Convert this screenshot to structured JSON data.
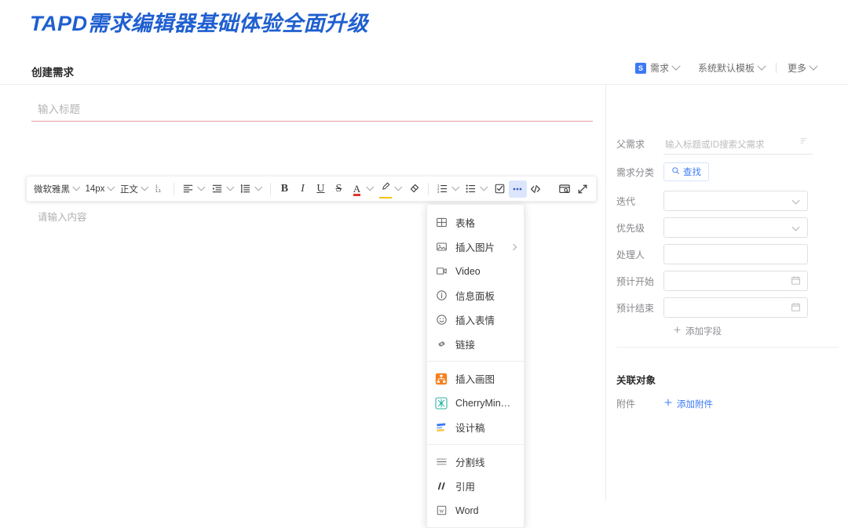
{
  "banner": {
    "title": "TAPD需求编辑器基础体验全面升级"
  },
  "header": {
    "title": "创建需求",
    "badge": "S",
    "type_label": "需求",
    "template_label": "系统默认模板",
    "more_label": "更多"
  },
  "editor": {
    "title_placeholder": "输入标题",
    "content_placeholder": "请输入内容",
    "toolbar": {
      "font_family": "微软雅黑",
      "font_size": "14px",
      "paragraph_style": "正文",
      "heading_number_icon": "heading-number-icon",
      "align_icon": "align-left-icon",
      "indent_icon": "indent-icon",
      "line_height_icon": "line-height-icon",
      "bold": "B",
      "italic": "I",
      "underline": "U",
      "strike": "S",
      "font_color": "A",
      "highlight_icon": "highlight-pen-icon",
      "clear_format_icon": "clear-format-icon",
      "ordered_list_icon": "ordered-list-icon",
      "bullet_list_icon": "bullet-list-icon",
      "checklist_icon": "checklist-icon",
      "more_icon": "more-dots-icon",
      "code_icon": "code-icon",
      "preview_icon": "preview-screen-icon",
      "fullscreen_icon": "fullscreen-expand-icon"
    }
  },
  "menu": {
    "groups": [
      {
        "items": [
          {
            "label": "表格",
            "icon": "table-icon",
            "submenu": false
          },
          {
            "label": "插入图片",
            "icon": "image-icon",
            "submenu": true
          },
          {
            "label": "Video",
            "icon": "video-icon",
            "submenu": false
          },
          {
            "label": "信息面板",
            "icon": "info-panel-icon",
            "submenu": false
          },
          {
            "label": "插入表情",
            "icon": "emoji-icon",
            "submenu": false
          },
          {
            "label": "链接",
            "icon": "link-icon",
            "submenu": false
          }
        ]
      },
      {
        "items": [
          {
            "label": "插入画图",
            "icon": "flowchart-icon",
            "submenu": false
          },
          {
            "label": "CherryMin…",
            "icon": "mindmap-icon",
            "submenu": false
          },
          {
            "label": "设计稿",
            "icon": "design-doc-icon",
            "submenu": false
          }
        ]
      },
      {
        "items": [
          {
            "label": "分割线",
            "icon": "divider-icon",
            "submenu": false
          },
          {
            "label": "引用",
            "icon": "quote-icon",
            "submenu": false
          },
          {
            "label": "Word",
            "icon": "word-icon",
            "submenu": false
          }
        ]
      }
    ]
  },
  "sidebar": {
    "fields": [
      {
        "label": "父需求",
        "type": "line-input",
        "placeholder": "输入标题或ID搜索父需求",
        "trailing_icon": "filter-tiny-icon"
      },
      {
        "label": "需求分类",
        "type": "search-button",
        "button_label": "查找",
        "icon": "search-icon"
      },
      {
        "label": "迭代",
        "type": "select",
        "value": ""
      },
      {
        "label": "优先级",
        "type": "select",
        "value": ""
      },
      {
        "label": "处理人",
        "type": "text-box",
        "value": ""
      },
      {
        "label": "预计开始",
        "type": "date-box",
        "value": "",
        "icon": "calendar-icon"
      },
      {
        "label": "预计结束",
        "type": "date-box",
        "value": "",
        "icon": "calendar-icon"
      }
    ],
    "add_field_label": "添加字段",
    "related_section_title": "关联对象",
    "attachment_label": "附件",
    "add_attachment_label": "添加附件"
  },
  "colors": {
    "brand_blue": "#1f5fd0",
    "link_blue": "#3b79f6",
    "title_underline": "#e9a0a4",
    "active_bg": "#dbe6fd"
  }
}
